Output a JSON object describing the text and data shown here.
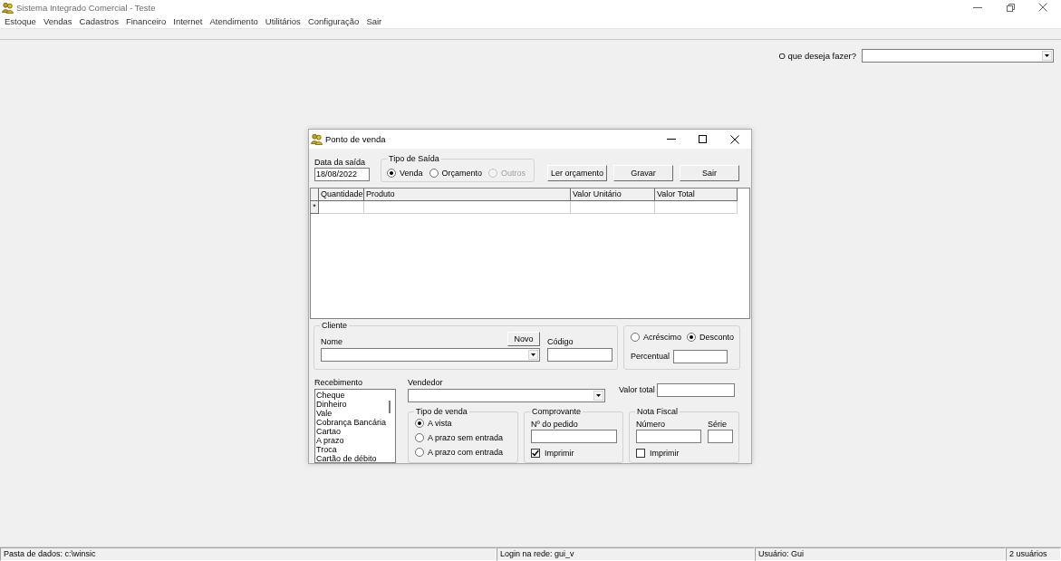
{
  "window": {
    "title": "Sistema Integrado Comercial - Teste"
  },
  "menu": [
    "Estoque",
    "Vendas",
    "Cadastros",
    "Financeiro",
    "Internet",
    "Atendimento",
    "Utilitários",
    "Configuração",
    "Sair"
  ],
  "action_search": {
    "label": "O que deseja fazer?"
  },
  "dialog": {
    "title": "Ponto de venda",
    "date": {
      "label": "Data da saída",
      "value": "18/08/2022"
    },
    "tipo_saida": {
      "label": "Tipo de Saída",
      "options": [
        {
          "label": "Venda",
          "selected": true,
          "disabled": false
        },
        {
          "label": "Orçamento",
          "selected": false,
          "disabled": false
        },
        {
          "label": "Outros",
          "selected": false,
          "disabled": true
        }
      ]
    },
    "buttons": [
      "Ler orçamento",
      "Gravar",
      "Sair"
    ],
    "grid": {
      "columns": [
        "Quantidade",
        "Produto",
        "Valor Unitário",
        "Valor Total"
      ],
      "new_row_marker": "*"
    },
    "cliente": {
      "label": "Cliente",
      "nome_label": "Nome",
      "novo_button": "Novo",
      "codigo_label": "Código"
    },
    "ajuste": {
      "options": [
        {
          "label": "Acréscimo",
          "selected": false
        },
        {
          "label": "Desconto",
          "selected": true
        }
      ],
      "percentual_label": "Percentual"
    },
    "recebimento": {
      "label": "Recebimento",
      "items": [
        {
          "label": "Cheque",
          "selected": false
        },
        {
          "label": "Dinheiro",
          "selected": false
        },
        {
          "label": "Vale",
          "selected": false
        },
        {
          "label": "Cobrança Bancária",
          "selected": false
        },
        {
          "label": "Cartao",
          "selected": false
        },
        {
          "label": "A prazo",
          "selected": false
        },
        {
          "label": "Troca",
          "selected": false
        },
        {
          "label": "Cartão de débito",
          "selected": false
        }
      ]
    },
    "vendedor": {
      "label": "Vendedor"
    },
    "valor_total": {
      "label": "Valor total"
    },
    "tipo_venda": {
      "label": "Tipo de venda",
      "options": [
        {
          "label": "A vista",
          "selected": true
        },
        {
          "label": "A prazo sem entrada",
          "selected": false
        },
        {
          "label": "A prazo com entrada",
          "selected": false
        }
      ]
    },
    "comprovante": {
      "label": "Comprovante",
      "pedido_label": "Nº do pedido",
      "imprimir": {
        "label": "Imprimir",
        "checked": true
      }
    },
    "nota_fiscal": {
      "label": "Nota Fiscal",
      "numero_label": "Número",
      "serie_label": "Série",
      "imprimir": {
        "label": "Imprimir",
        "checked": false
      }
    }
  },
  "status_bar": [
    "Pasta de dados: c:\\winsic",
    "Login na rede: gui_v",
    "Usuário: Gui",
    "2 usuários"
  ]
}
